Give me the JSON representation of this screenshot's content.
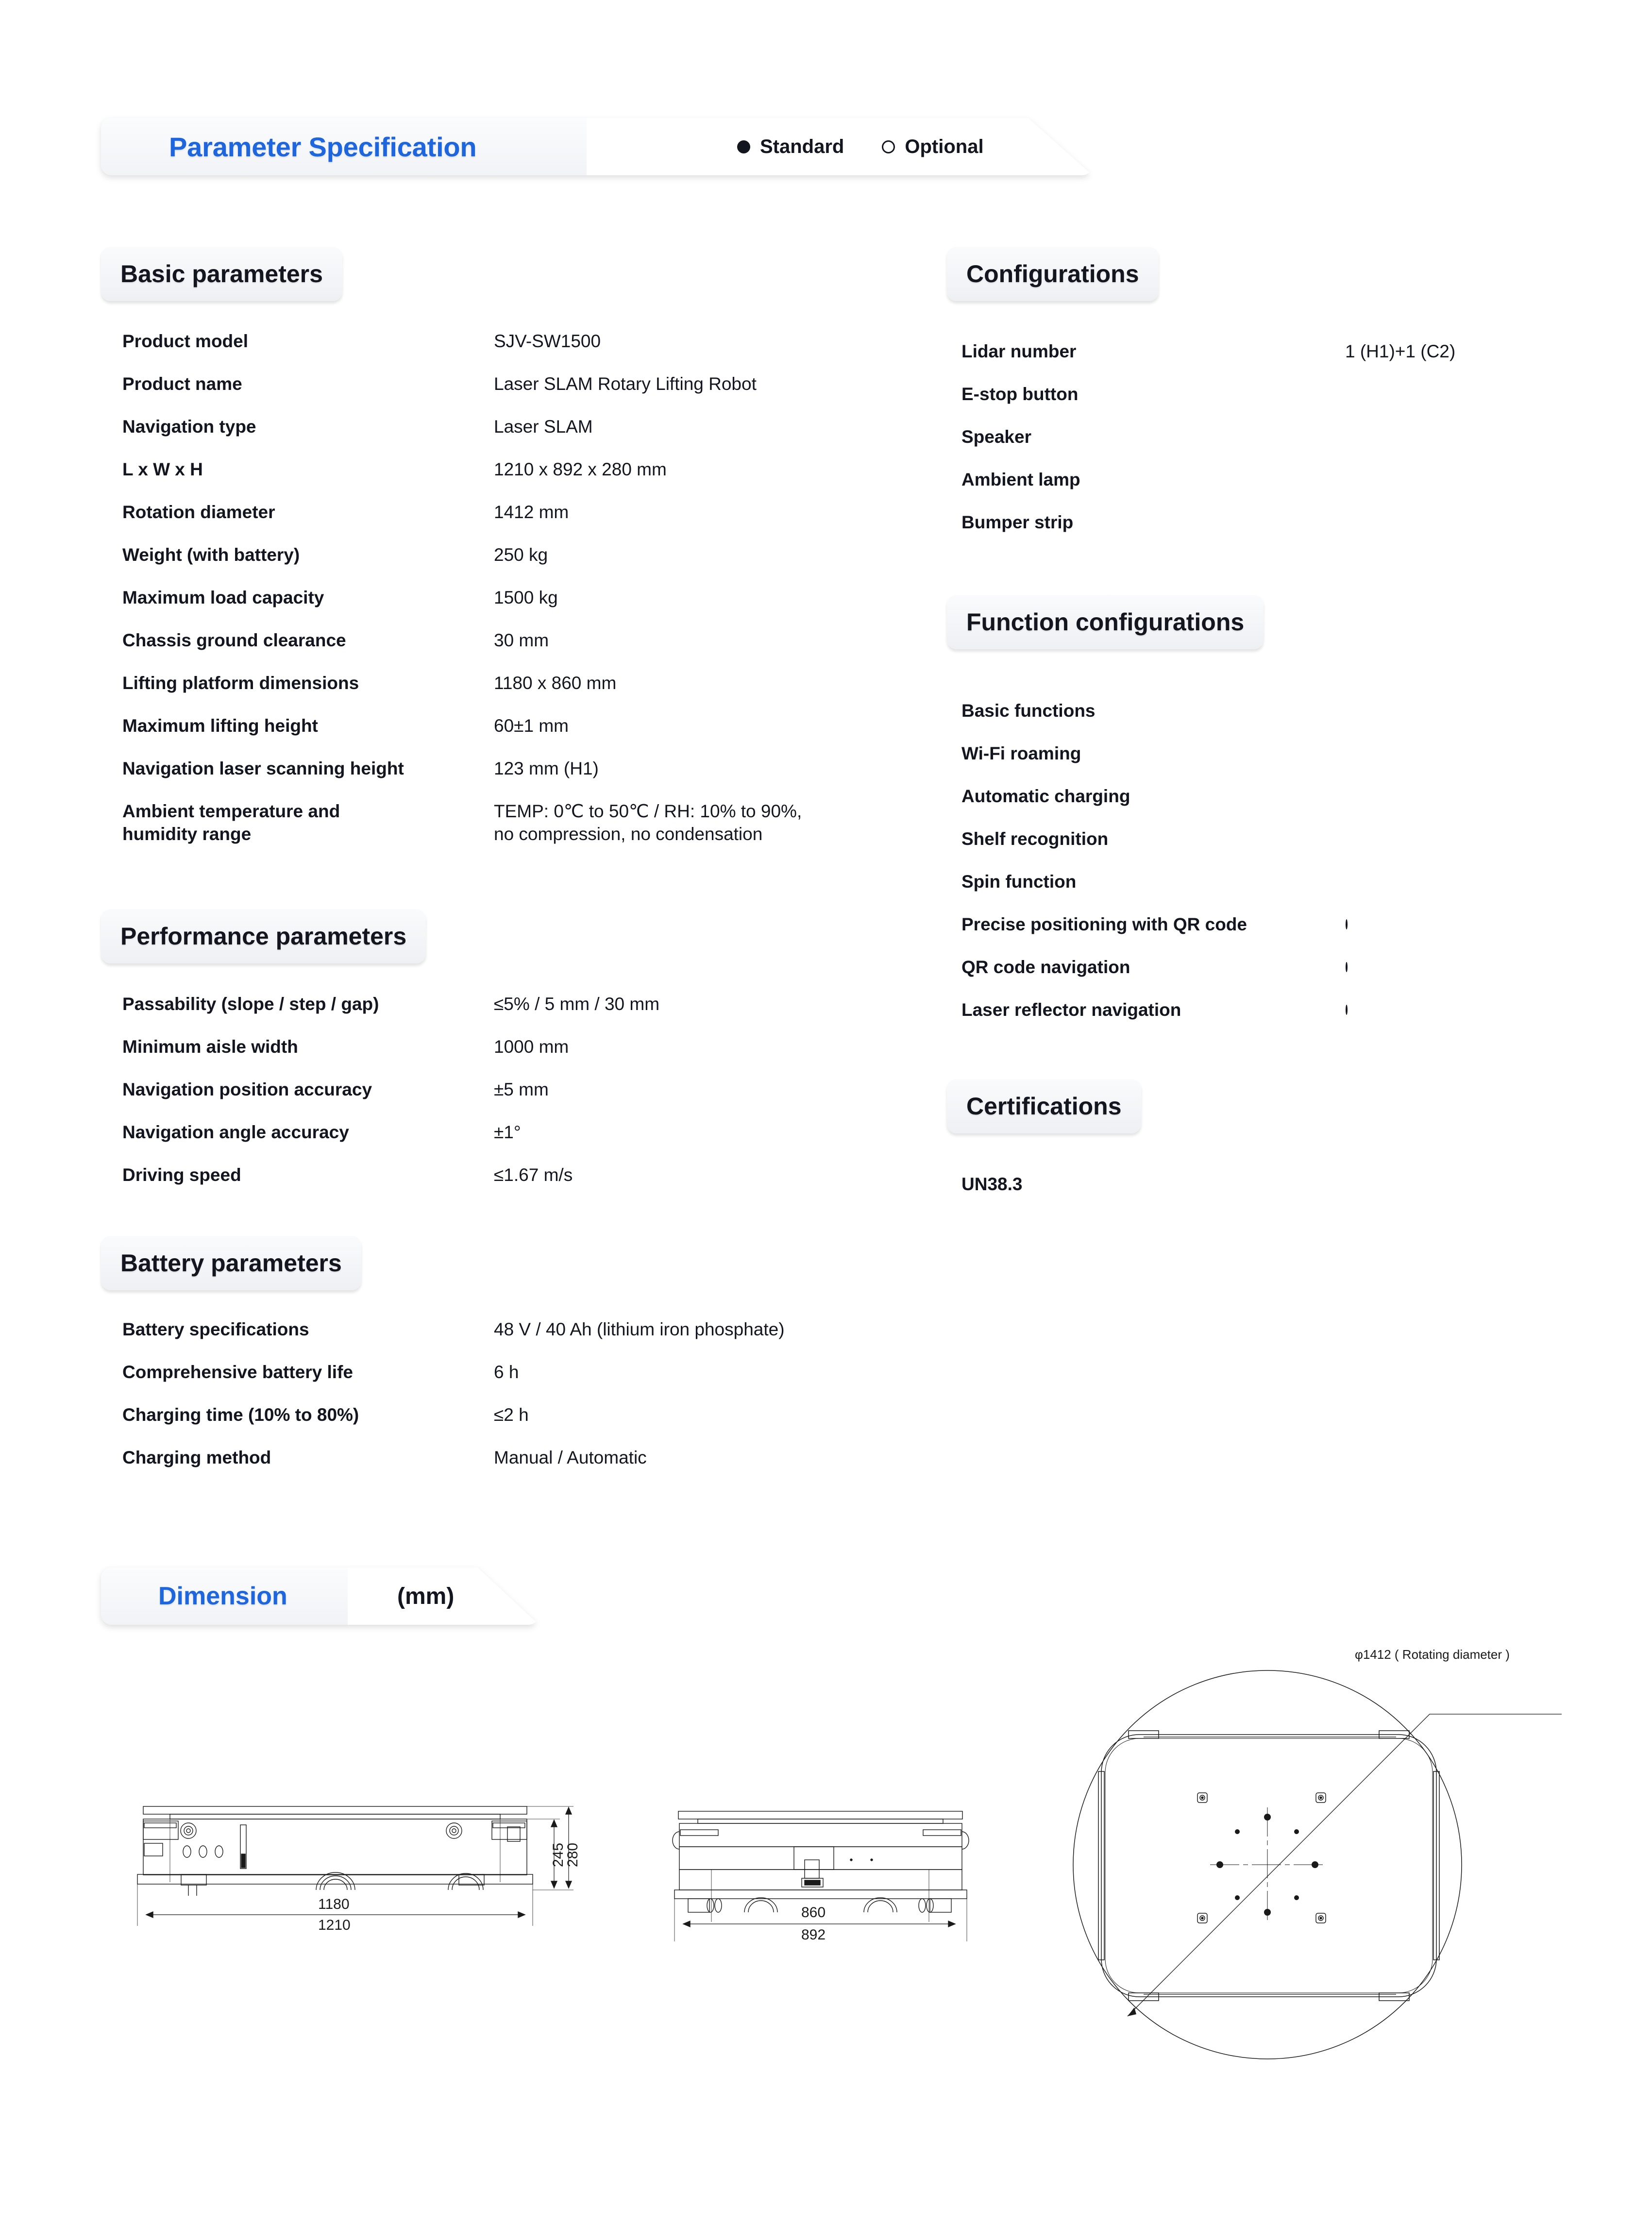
{
  "banner": {
    "title": "Parameter Specification",
    "legend": [
      {
        "label": "Standard",
        "type": "solid"
      },
      {
        "label": "Optional",
        "type": "hollow"
      }
    ]
  },
  "sections": {
    "basic": {
      "heading": "Basic parameters",
      "rows": [
        {
          "label": "Product model",
          "value": "SJV-SW1500"
        },
        {
          "label": "Product name",
          "value": "Laser SLAM Rotary Lifting Robot"
        },
        {
          "label": "Navigation type",
          "value": "Laser SLAM"
        },
        {
          "label": "L x W x H",
          "value": "1210 x 892 x 280 mm"
        },
        {
          "label": "Rotation diameter",
          "value": "1412 mm"
        },
        {
          "label": "Weight (with battery)",
          "value": "250 kg"
        },
        {
          "label": "Maximum load capacity",
          "value": "1500 kg"
        },
        {
          "label": "Chassis ground clearance",
          "value": "30 mm"
        },
        {
          "label": "Lifting platform dimensions",
          "value": "1180 x 860 mm"
        },
        {
          "label": "Maximum lifting height",
          "value": "60±1 mm"
        },
        {
          "label": "Navigation laser scanning height",
          "value": "123 mm (H1)"
        },
        {
          "label": "Ambient temperature and\nhumidity range",
          "value": "TEMP: 0℃ to 50℃ / RH: 10% to 90%,\nno compression, no condensation"
        }
      ]
    },
    "performance": {
      "heading": "Performance parameters",
      "rows": [
        {
          "label": "Passability (slope / step / gap)",
          "value": "≤5% / 5 mm / 30 mm"
        },
        {
          "label": "Minimum aisle width",
          "value": "1000 mm"
        },
        {
          "label": "Navigation position accuracy",
          "value": "±5 mm"
        },
        {
          "label": "Navigation angle accuracy",
          "value": "±1°"
        },
        {
          "label": "Driving speed",
          "value": "≤1.67 m/s"
        }
      ]
    },
    "battery": {
      "heading": "Battery parameters",
      "rows": [
        {
          "label": "Battery specifications",
          "value": "48 V / 40 Ah (lithium iron phosphate)"
        },
        {
          "label": "Comprehensive battery life",
          "value": "6 h"
        },
        {
          "label": "Charging time (10% to 80%)",
          "value": "≤2 h"
        },
        {
          "label": "Charging method",
          "value": "Manual / Automatic"
        }
      ]
    },
    "configurations": {
      "heading": "Configurations",
      "rows": [
        {
          "label": "Lidar number",
          "mark": "text",
          "value": "1 (H1)+1 (C2)"
        },
        {
          "label": "E-stop button",
          "mark": "solid"
        },
        {
          "label": "Speaker",
          "mark": "solid"
        },
        {
          "label": "Ambient lamp",
          "mark": "solid"
        },
        {
          "label": "Bumper strip",
          "mark": "solid"
        }
      ]
    },
    "functions": {
      "heading": "Function configurations",
      "rows": [
        {
          "label": "Basic functions",
          "mark": "solid"
        },
        {
          "label": "Wi-Fi roaming",
          "mark": "solid"
        },
        {
          "label": "Automatic charging",
          "mark": "solid"
        },
        {
          "label": "Shelf recognition",
          "mark": "solid"
        },
        {
          "label": "Spin function",
          "mark": "solid"
        },
        {
          "label": "Precise positioning with QR code",
          "mark": "hollow"
        },
        {
          "label": "QR code navigation",
          "mark": "hollow"
        },
        {
          "label": "Laser reflector navigation",
          "mark": "hollow"
        }
      ]
    },
    "certifications": {
      "heading": "Certifications",
      "rows": [
        {
          "label": "UN38.3",
          "mark": "solid"
        }
      ]
    }
  },
  "dimension": {
    "title": "Dimension",
    "unit": "(mm)",
    "side_view": {
      "width_inner": "1180",
      "width_outer": "1210",
      "height_inner": "245",
      "height_outer": "280"
    },
    "front_view": {
      "width_inner": "860",
      "width_outer": "892"
    },
    "top_view": {
      "rotating_diameter": "φ1412 ( Rotating diameter )"
    }
  },
  "colors": {
    "accent_blue": "#1e66dd",
    "text_dark": "#14161f",
    "dot_dark": "#16182a",
    "pill_bg": "#eef0f4"
  }
}
